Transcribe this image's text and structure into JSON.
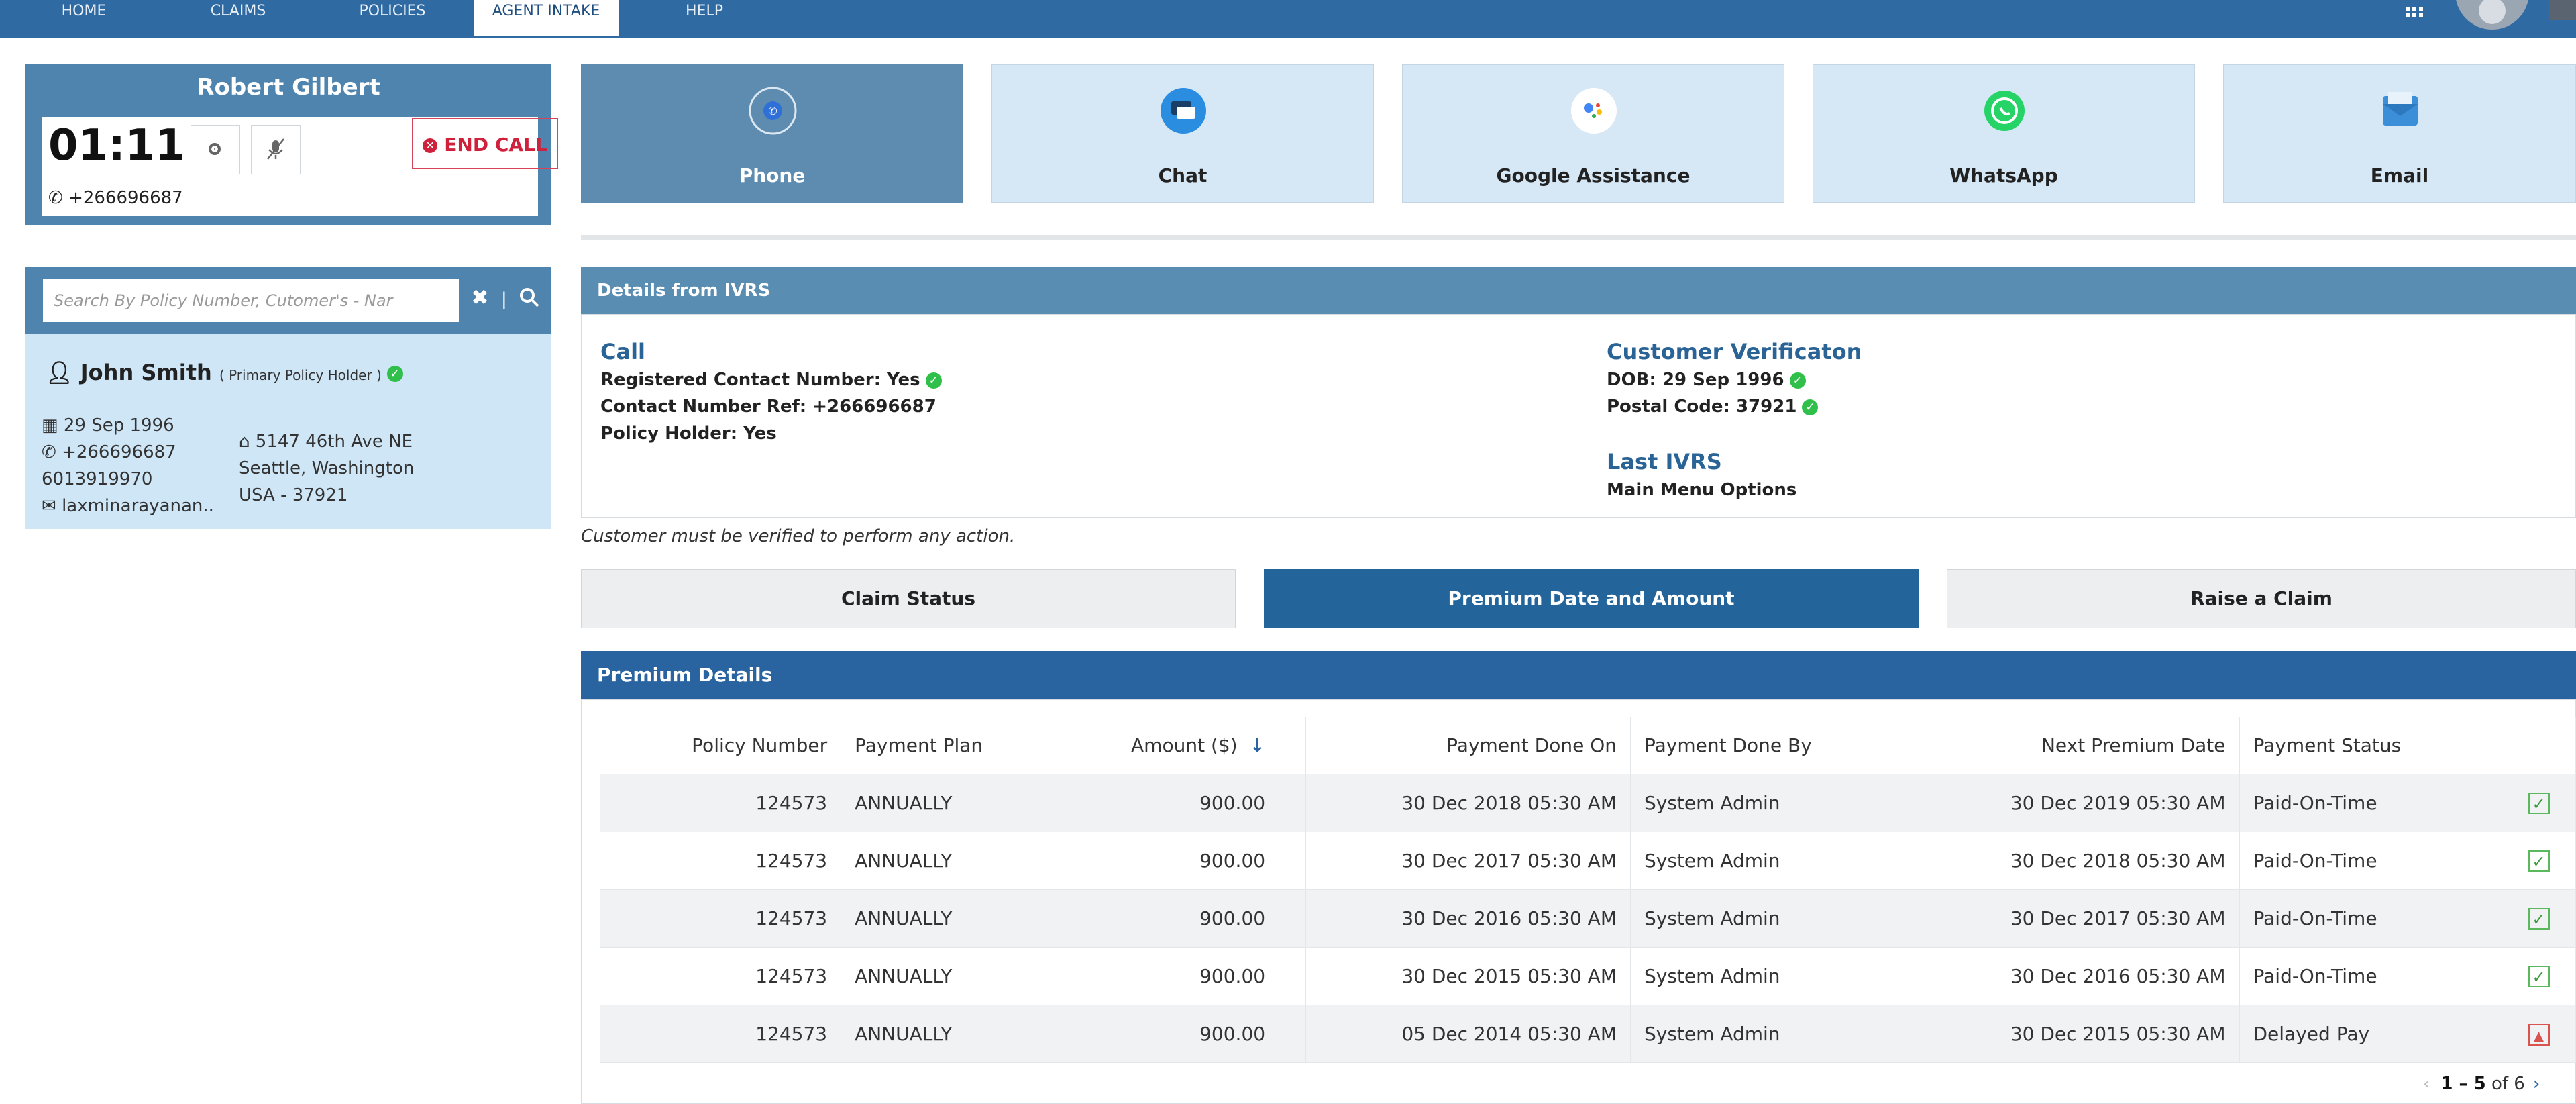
{
  "nav": {
    "items": [
      "HOME",
      "CLAIMS",
      "POLICIES",
      "AGENT INTAKE",
      "HELP"
    ],
    "active": "AGENT INTAKE"
  },
  "call": {
    "agent_name": "Robert Gilbert",
    "timer": "01:11",
    "end_call_label": "END CALL",
    "phone": "+266696687"
  },
  "search": {
    "placeholder": "Search By Policy Number, Cutomer's - Nar"
  },
  "customer": {
    "name": "John Smith",
    "role": "( Primary Policy Holder )",
    "dob": "29 Sep 1996",
    "phone": "+266696687",
    "alt_phone": "6013919970",
    "email": "laxminarayanan..",
    "address_line1": "5147 46th Ave NE",
    "address_line2": "Seattle, Washington",
    "address_line3": "USA - 37921"
  },
  "channels": [
    {
      "label": "Phone",
      "icon": "phone-icon"
    },
    {
      "label": "Chat",
      "icon": "chat-icon"
    },
    {
      "label": "Google Assistance",
      "icon": "google-assistant-icon"
    },
    {
      "label": "WhatsApp",
      "icon": "whatsapp-icon"
    },
    {
      "label": "Email",
      "icon": "email-icon"
    }
  ],
  "ivrs": {
    "header": "Details from IVRS",
    "call_title": "Call",
    "registered_contact": "Registered Contact Number: Yes",
    "contact_ref": "Contact Number Ref:  +266696687",
    "policy_holder": "Policy Holder: Yes",
    "verification_title": "Customer Verificaton",
    "dob": "DOB: 29 Sep 1996",
    "postal": "Postal Code: 37921",
    "last_ivrs_title": "Last IVRS",
    "last_ivrs_value": "Main Menu Options"
  },
  "notice": "Customer must be verified to perform any action.",
  "actions": [
    "Claim Status",
    "Premium Date and Amount",
    "Raise a Claim"
  ],
  "premium": {
    "header": "Premium Details",
    "columns": [
      "Policy Number",
      "Payment Plan",
      "Amount ($)",
      "Payment Done On",
      "Payment Done By",
      "Next Premium Date",
      "Payment Status"
    ],
    "rows": [
      [
        "124573",
        "ANNUALLY",
        "900.00",
        "30 Dec 2018 05:30 AM",
        "System Admin",
        "30 Dec 2019 05:30 AM",
        "Paid-On-Time"
      ],
      [
        "124573",
        "ANNUALLY",
        "900.00",
        "30 Dec 2017 05:30 AM",
        "System Admin",
        "30 Dec 2018 05:30 AM",
        "Paid-On-Time"
      ],
      [
        "124573",
        "ANNUALLY",
        "900.00",
        "30 Dec 2016 05:30 AM",
        "System Admin",
        "30 Dec 2017 05:30 AM",
        "Paid-On-Time"
      ],
      [
        "124573",
        "ANNUALLY",
        "900.00",
        "30 Dec 2015 05:30 AM",
        "System Admin",
        "30 Dec 2016 05:30 AM",
        "Paid-On-Time"
      ],
      [
        "124573",
        "ANNUALLY",
        "900.00",
        "05 Dec 2014 05:30 AM",
        "System Admin",
        "30 Dec 2015 05:30 AM",
        "Delayed Pay"
      ]
    ],
    "pager_range": "1 – 5",
    "pager_total": "of 6"
  },
  "colors": {
    "nav_bg": "#2f6aa3",
    "panel_blue": "#4f84ae",
    "accent": "#2a64a0",
    "light_blue": "#d6e8f6",
    "success": "#2fbf4a",
    "danger": "#d9534f"
  }
}
